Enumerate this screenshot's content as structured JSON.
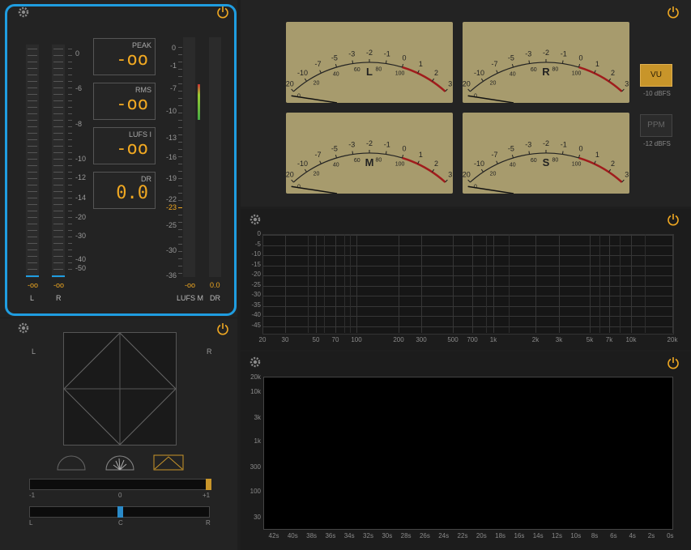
{
  "levels": {
    "scale": [
      "0",
      "-6",
      "-8",
      "-10",
      "-12",
      "-14",
      "-20",
      "-30",
      "-40",
      "-50"
    ],
    "channels": [
      "L",
      "R"
    ],
    "peak_readouts": [
      "-oo",
      "-oo"
    ],
    "boxes": [
      {
        "title": "PEAK",
        "value": "-oo"
      },
      {
        "title": "RMS",
        "value": "-oo"
      },
      {
        "title": "LUFS I",
        "value": "-oo"
      },
      {
        "title": "DR",
        "value": "0.0"
      }
    ],
    "lufs_scale": [
      "0",
      "-1",
      "-7",
      "-10",
      "-13",
      "-16",
      "-19",
      "-22",
      "-23",
      "-25",
      "-30",
      "-36"
    ],
    "lufs_label": "LUFS M",
    "dr_label": "DR",
    "lufs_readout": "-oo",
    "dr_readout": "0.0",
    "accent": "#f0a822",
    "highlight_border": "#1f9de0"
  },
  "vu": {
    "meters": [
      "L",
      "R",
      "M",
      "S"
    ],
    "scale": [
      "-20",
      "-10",
      "-7",
      "-5",
      "-3",
      "-2",
      "-1",
      "0",
      "1",
      "2",
      "3"
    ],
    "inner": [
      "0",
      "20",
      "40",
      "60",
      "80",
      "100"
    ],
    "modes": [
      {
        "label": "VU",
        "sub": "-10 dBFS",
        "active": true
      },
      {
        "label": "PPM",
        "sub": "-12 dBFS",
        "active": false
      }
    ]
  },
  "spectrum": {
    "y": [
      "0",
      "-5",
      "-10",
      "-15",
      "-20",
      "-25",
      "-30",
      "-35",
      "-40",
      "-45"
    ],
    "x": [
      "20",
      "30",
      "50",
      "70",
      "100",
      "200",
      "300",
      "500",
      "700",
      "1k",
      "2k",
      "3k",
      "5k",
      "7k",
      "10k",
      "20k"
    ]
  },
  "spectrogram": {
    "y": [
      "20k",
      "10k",
      "3k",
      "1k",
      "300",
      "100",
      "30"
    ],
    "x": [
      "42s",
      "40s",
      "38s",
      "36s",
      "34s",
      "32s",
      "30s",
      "28s",
      "26s",
      "24s",
      "22s",
      "20s",
      "18s",
      "16s",
      "14s",
      "12s",
      "10s",
      "8s",
      "6s",
      "4s",
      "2s",
      "0s"
    ]
  },
  "stereo": {
    "left": "L",
    "right": "R",
    "balance": {
      "left": "-1",
      "center": "0",
      "right": "+1"
    },
    "pan": {
      "left": "L",
      "center": "C",
      "right": "R"
    }
  }
}
